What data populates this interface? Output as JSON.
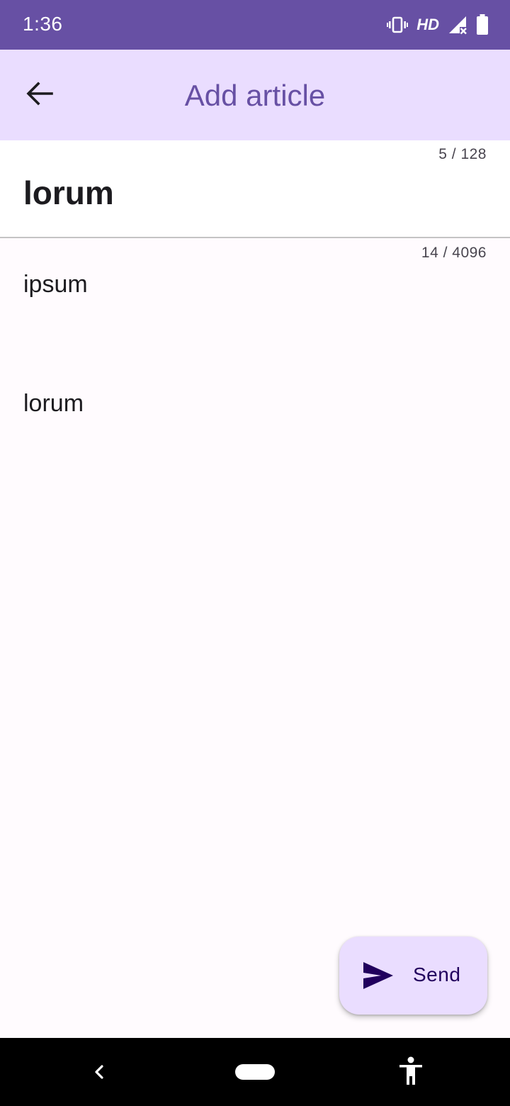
{
  "status_bar": {
    "time": "1:36",
    "network_label": "HD",
    "icons": [
      "vibrate-icon",
      "hd-icon",
      "signal-off-icon",
      "battery-icon"
    ],
    "background_color": "#6750a4"
  },
  "app_bar": {
    "title": "Add article",
    "back_icon": "arrow-back-icon",
    "background_color": "#eaddff",
    "title_color": "#6750a4"
  },
  "title_field": {
    "counter": "5 / 128",
    "value": "lorum"
  },
  "body_field": {
    "counter": "14 / 4096",
    "lines": [
      "ipsum",
      "",
      "",
      "",
      "lorum"
    ]
  },
  "fab": {
    "label": "Send",
    "icon": "send-icon",
    "background_color": "#eaddff",
    "foreground_color": "#21005d"
  },
  "nav_bar": {
    "icons": [
      "nav-back-icon",
      "nav-home-pill",
      "accessibility-icon"
    ]
  }
}
